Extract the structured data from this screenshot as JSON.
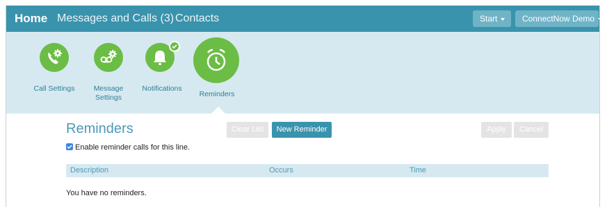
{
  "topnav": {
    "home": "Home",
    "messages_calls": "Messages and Calls (3)",
    "contacts": "Contacts",
    "start_button": "Start",
    "account_button": "ConnectNow Demo"
  },
  "tiles": [
    {
      "label": "Call Settings",
      "icon": "phone-gear-icon"
    },
    {
      "label": "Message Settings",
      "icon": "voicemail-gear-icon"
    },
    {
      "label": "Notifications",
      "icon": "bell-icon",
      "badge": "check-icon"
    },
    {
      "label": "Reminders",
      "icon": "alarm-clock-icon",
      "active": true
    }
  ],
  "main": {
    "title": "Reminders",
    "clear_list": "Clear List",
    "new_reminder": "New Reminder",
    "apply": "Apply",
    "cancel": "Cancel",
    "enable_label": "Enable reminder calls for this line.",
    "enable_checked": true
  },
  "table": {
    "columns": [
      "Description",
      "Occurs",
      "Time"
    ],
    "empty_message": "You have no reminders."
  },
  "colors": {
    "nav_bg": "#3a93ad",
    "strip_bg": "#d6e9f0",
    "tile_green": "#6bbd45",
    "accent_text": "#4a9ab5"
  }
}
